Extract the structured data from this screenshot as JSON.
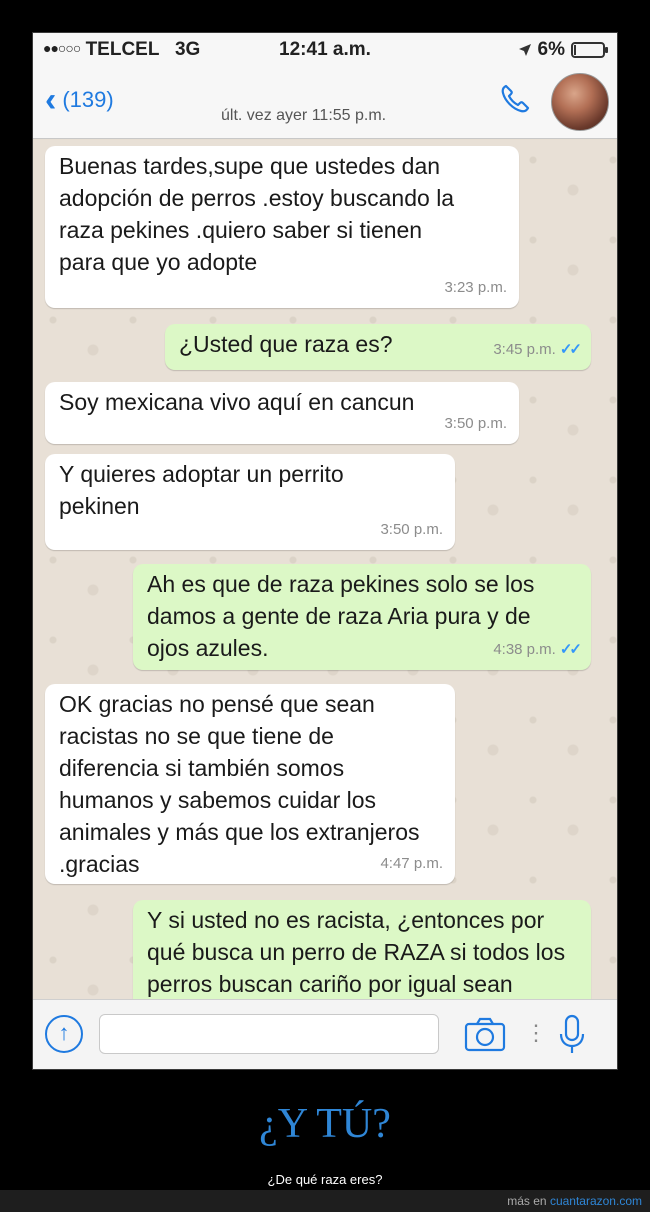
{
  "status_bar": {
    "carrier": "TELCEL",
    "network": "3G",
    "time": "12:41 a.m.",
    "battery": "6%",
    "battery_level": 0.06
  },
  "header": {
    "back_label": "(139)",
    "last_seen": "últ. vez ayer 11:55 p.m."
  },
  "messages": [
    {
      "direction": "in",
      "text": "Buenas tardes,supe que ustedes dan adopción de perros  .estoy buscando la raza pekines .quiero saber si tienen para que yo  adopte",
      "time": "3:23 p.m."
    },
    {
      "direction": "out",
      "text": "¿Usted que raza es?",
      "time": "3:45 p.m."
    },
    {
      "direction": "in",
      "text": "Soy mexicana  vivo aquí en cancun",
      "time": "3:50 p.m."
    },
    {
      "direction": "in",
      "text": "Y quieres adoptar un perrito pekinen",
      "time": "3:50 p.m."
    },
    {
      "direction": "out",
      "text": "Ah es que de raza pekines solo se los damos a gente de raza Aria pura y de ojos azules.",
      "time": "4:38 p.m."
    },
    {
      "direction": "in",
      "text": "OK gracias no pensé que sean racistas no se que tiene de diferencia si también somos humanos y sabemos cuidar los animales y más que los extranjeros  .gracias",
      "time": "4:47 p.m."
    },
    {
      "direction": "out",
      "text": "Y si usted no es racista, ¿entonces por qué busca un perro de RAZA si todos los perros buscan cariño por igual sean criollos o de raza?",
      "time": ""
    }
  ],
  "input_bar": {
    "placeholder": ""
  },
  "caption": {
    "title": "¿Y TÚ?",
    "subtitle": "¿De qué raza eres?"
  },
  "footer": {
    "prefix": "más en",
    "site": "cuantarazon.com"
  },
  "colors": {
    "accent": "#1f7ae0",
    "outgoing_bubble": "#dcf8c6",
    "incoming_bubble": "#ffffff",
    "read_ticks": "#3497f9",
    "caption_title": "#2f86d6"
  }
}
